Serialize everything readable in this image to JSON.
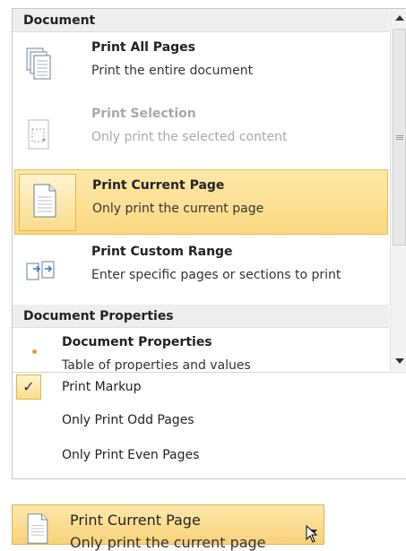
{
  "sections": {
    "document": "Document",
    "document_properties": "Document Properties"
  },
  "items": [
    {
      "title": "Print All Pages",
      "desc": "Print the entire document",
      "icon": "pages-stack-icon",
      "state": "normal"
    },
    {
      "title": "Print Selection",
      "desc": "Only print the selected content",
      "icon": "selection-page-icon",
      "state": "disabled"
    },
    {
      "title": "Print Current Page",
      "desc": "Only print the current page",
      "icon": "single-page-icon",
      "state": "selected"
    },
    {
      "title": "Print Custom Range",
      "desc": "Enter specific pages or sections to print",
      "icon": "page-range-icon",
      "state": "normal"
    }
  ],
  "properties_item": {
    "title": "Document Properties",
    "desc": "Table of properties and values",
    "icon": "bullet-icon"
  },
  "checks": [
    {
      "label": "Print Markup",
      "checked": true
    },
    {
      "label": "Only Print Odd Pages",
      "checked": false
    },
    {
      "label": "Only Print Even Pages",
      "checked": false
    }
  ],
  "current_selection": {
    "title": "Print Current Page",
    "desc": "Only print the current page",
    "icon": "single-page-icon"
  },
  "colors": {
    "highlight": "#fbd981",
    "highlight_border": "#e8bd5b",
    "header_bg": "#eeeeee",
    "disabled_text": "#a9a9a9"
  }
}
